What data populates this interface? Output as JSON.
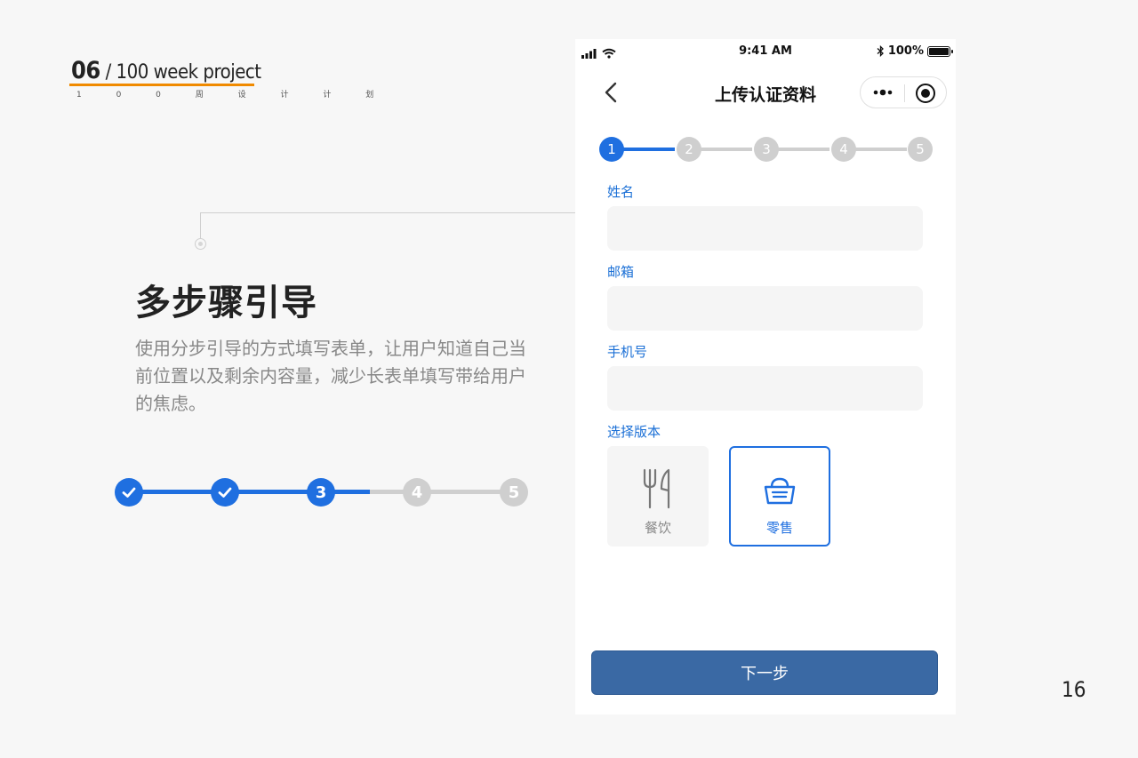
{
  "brand": {
    "num": "06",
    "rest": " / 100 week project",
    "subtitle": "1 0 0 周 设 计 计 划"
  },
  "content": {
    "title": "多步骤引导",
    "description": "使用分步引导的方式填写表单，让用户知道自己当前位置以及剩余内容量，减少长表单填写带给用户的焦虑。"
  },
  "left_stepper": {
    "current": "3",
    "next1": "4",
    "next2": "5",
    "completed_icon": "check-icon",
    "accent": "#1f6fe0",
    "inactive": "#cfcfcf"
  },
  "phone": {
    "status": {
      "time": "9:41 AM",
      "battery": "100%"
    },
    "nav": {
      "title": "上传认证资料"
    },
    "stepper": [
      "1",
      "2",
      "3",
      "4",
      "5"
    ],
    "form": {
      "name_label": "姓名",
      "email_label": "邮箱",
      "phone_label": "手机号",
      "version_label": "选择版本",
      "options": [
        {
          "label": "餐饮",
          "icon": "fork-knife-icon",
          "selected": false
        },
        {
          "label": "零售",
          "icon": "basket-icon",
          "selected": true
        }
      ]
    },
    "next_button": "下一步"
  },
  "page_number": "16"
}
